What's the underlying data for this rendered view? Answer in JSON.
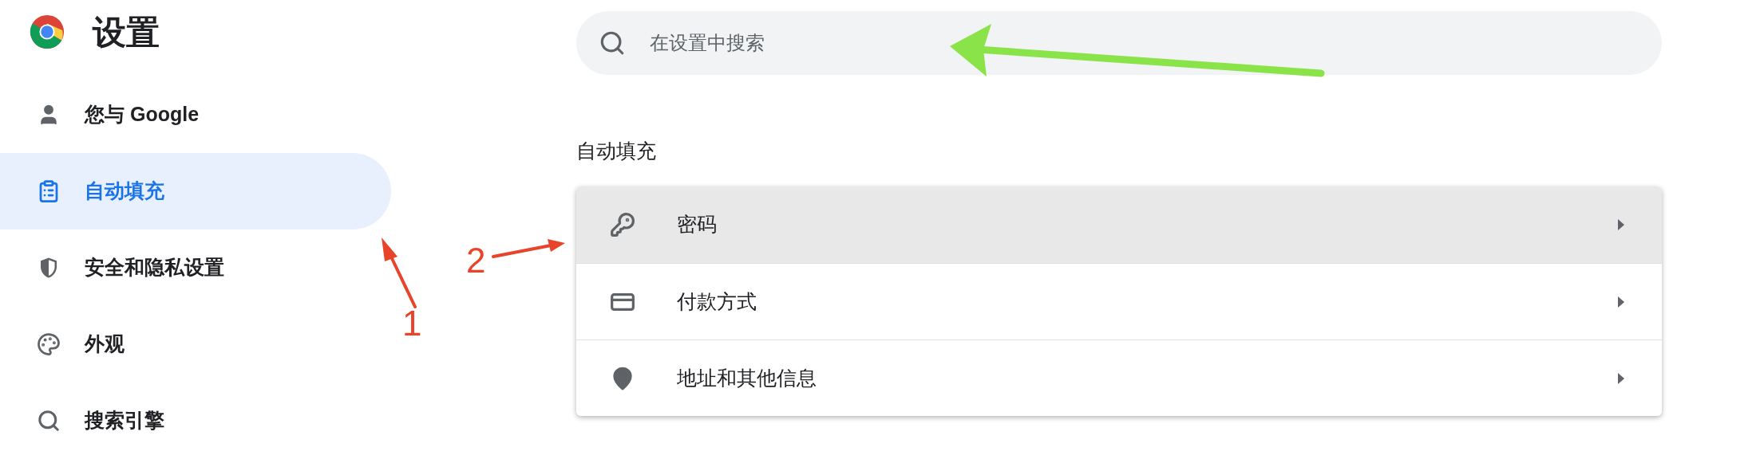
{
  "header": {
    "title": "设置"
  },
  "search": {
    "placeholder": "在设置中搜索"
  },
  "sidebar": {
    "items": [
      {
        "label": "您与 Google",
        "selected": false
      },
      {
        "label": "自动填充",
        "selected": true
      },
      {
        "label": "安全和隐私设置",
        "selected": false
      },
      {
        "label": "外观",
        "selected": false
      },
      {
        "label": "搜索引擎",
        "selected": false
      }
    ]
  },
  "section": {
    "heading": "自动填充",
    "rows": [
      {
        "label": "密码",
        "hovered": true
      },
      {
        "label": "付款方式",
        "hovered": false
      },
      {
        "label": "地址和其他信息",
        "hovered": false
      }
    ]
  },
  "annotations": [
    {
      "label": "1"
    },
    {
      "label": "2"
    }
  ]
}
